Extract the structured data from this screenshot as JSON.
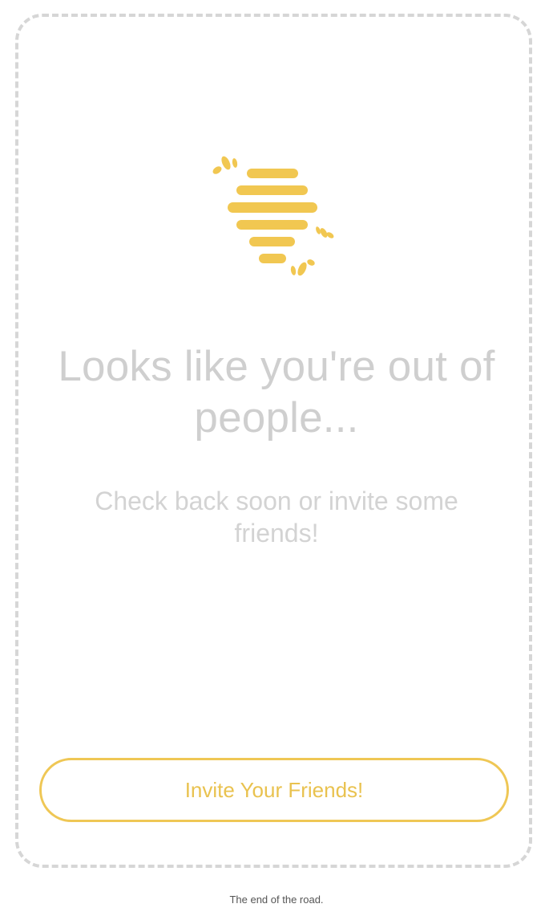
{
  "empty_state": {
    "headline": "Looks like you're out of people...",
    "subline": "Check back soon or invite some friends!",
    "logo_icon": "beehive-icon",
    "logo_color": "#F1C751"
  },
  "actions": {
    "invite_label": "Invite Your Friends!",
    "accent_color": "#EFC755"
  },
  "footer": {
    "text": "The end of the road."
  }
}
